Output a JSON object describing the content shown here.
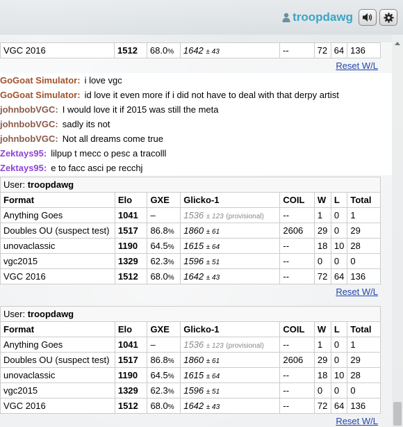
{
  "header": {
    "username": "troopdawg",
    "sound_icon": "speaker-icon",
    "settings_icon": "gear-icon"
  },
  "colors": {
    "username": "#3aa5c6",
    "gogoat": "#a0522d",
    "johnbob": "#8b5a4a",
    "zektays": "#8e44d4",
    "link": "#2244aa"
  },
  "top_table": {
    "row": {
      "format": "VGC 2016",
      "elo": "1512",
      "gxe": "68.0",
      "gxe_pct": "%",
      "glicko": "1642",
      "glicko_dev": "± 43",
      "coil": "--",
      "w": "72",
      "l": "64",
      "total": "136"
    },
    "reset_label": "Reset W/L"
  },
  "messages": [
    {
      "nick": "GoGoat Simulator:",
      "text": "i love vgc",
      "color": "#a0522d"
    },
    {
      "nick": "GoGoat Simulator:",
      "text": "id love it even more if i did not have to deal with that derpy artist",
      "color": "#a0522d"
    },
    {
      "nick": "johnbobVGC:",
      "text": "I would love it if 2015 was still the meta",
      "color": "#8b5a4a"
    },
    {
      "nick": "johnbobVGC:",
      "text": "sadly its not",
      "color": "#8b5a4a"
    },
    {
      "nick": "johnbobVGC:",
      "text": "Not all dreams come true",
      "color": "#8b5a4a"
    },
    {
      "nick": "Zektays95:",
      "text": "lilpup t mecc o pesc a tracolll",
      "color": "#8e44d4"
    },
    {
      "nick": "Zektays95:",
      "text": "e to facc asci pe recchj",
      "color": "#8e44d4"
    }
  ],
  "rank_tables": [
    {
      "user_label": "User:",
      "user": "troopdawg",
      "headers": [
        "Format",
        "Elo",
        "GXE",
        "Glicko-1",
        "COIL",
        "W",
        "L",
        "Total"
      ],
      "rows": [
        {
          "format": "Anything Goes",
          "elo": "1041",
          "gxe": "–",
          "gxe_pct": "",
          "glicko": "1536",
          "glicko_dev": "± 123",
          "provisional": "(provisional)",
          "coil": "--",
          "w": "1",
          "l": "0",
          "total": "1"
        },
        {
          "format": "Doubles OU (suspect test)",
          "elo": "1517",
          "gxe": "86.8",
          "gxe_pct": "%",
          "glicko": "1860",
          "glicko_dev": "± 61",
          "provisional": "",
          "coil": "2606",
          "w": "29",
          "l": "0",
          "total": "29"
        },
        {
          "format": "unovaclassic",
          "elo": "1190",
          "gxe": "64.5",
          "gxe_pct": "%",
          "glicko": "1615",
          "glicko_dev": "± 64",
          "provisional": "",
          "coil": "--",
          "w": "18",
          "l": "10",
          "total": "28"
        },
        {
          "format": "vgc2015",
          "elo": "1329",
          "gxe": "62.3",
          "gxe_pct": "%",
          "glicko": "1596",
          "glicko_dev": "± 51",
          "provisional": "",
          "coil": "--",
          "w": "0",
          "l": "0",
          "total": "0"
        },
        {
          "format": "VGC 2016",
          "elo": "1512",
          "gxe": "68.0",
          "gxe_pct": "%",
          "glicko": "1642",
          "glicko_dev": "± 43",
          "provisional": "",
          "coil": "--",
          "w": "72",
          "l": "64",
          "total": "136"
        }
      ],
      "reset_label": "Reset W/L"
    },
    {
      "user_label": "User:",
      "user": "troopdawg",
      "headers": [
        "Format",
        "Elo",
        "GXE",
        "Glicko-1",
        "COIL",
        "W",
        "L",
        "Total"
      ],
      "rows": [
        {
          "format": "Anything Goes",
          "elo": "1041",
          "gxe": "–",
          "gxe_pct": "",
          "glicko": "1536",
          "glicko_dev": "± 123",
          "provisional": "(provisional)",
          "coil": "--",
          "w": "1",
          "l": "0",
          "total": "1"
        },
        {
          "format": "Doubles OU (suspect test)",
          "elo": "1517",
          "gxe": "86.8",
          "gxe_pct": "%",
          "glicko": "1860",
          "glicko_dev": "± 61",
          "provisional": "",
          "coil": "2606",
          "w": "29",
          "l": "0",
          "total": "29"
        },
        {
          "format": "unovaclassic",
          "elo": "1190",
          "gxe": "64.5",
          "gxe_pct": "%",
          "glicko": "1615",
          "glicko_dev": "± 64",
          "provisional": "",
          "coil": "--",
          "w": "18",
          "l": "10",
          "total": "28"
        },
        {
          "format": "vgc2015",
          "elo": "1329",
          "gxe": "62.3",
          "gxe_pct": "%",
          "glicko": "1596",
          "glicko_dev": "± 51",
          "provisional": "",
          "coil": "--",
          "w": "0",
          "l": "0",
          "total": "0"
        },
        {
          "format": "VGC 2016",
          "elo": "1512",
          "gxe": "68.0",
          "gxe_pct": "%",
          "glicko": "1642",
          "glicko_dev": "± 43",
          "provisional": "",
          "coil": "--",
          "w": "72",
          "l": "64",
          "total": "136"
        }
      ],
      "reset_label": "Reset W/L"
    }
  ]
}
